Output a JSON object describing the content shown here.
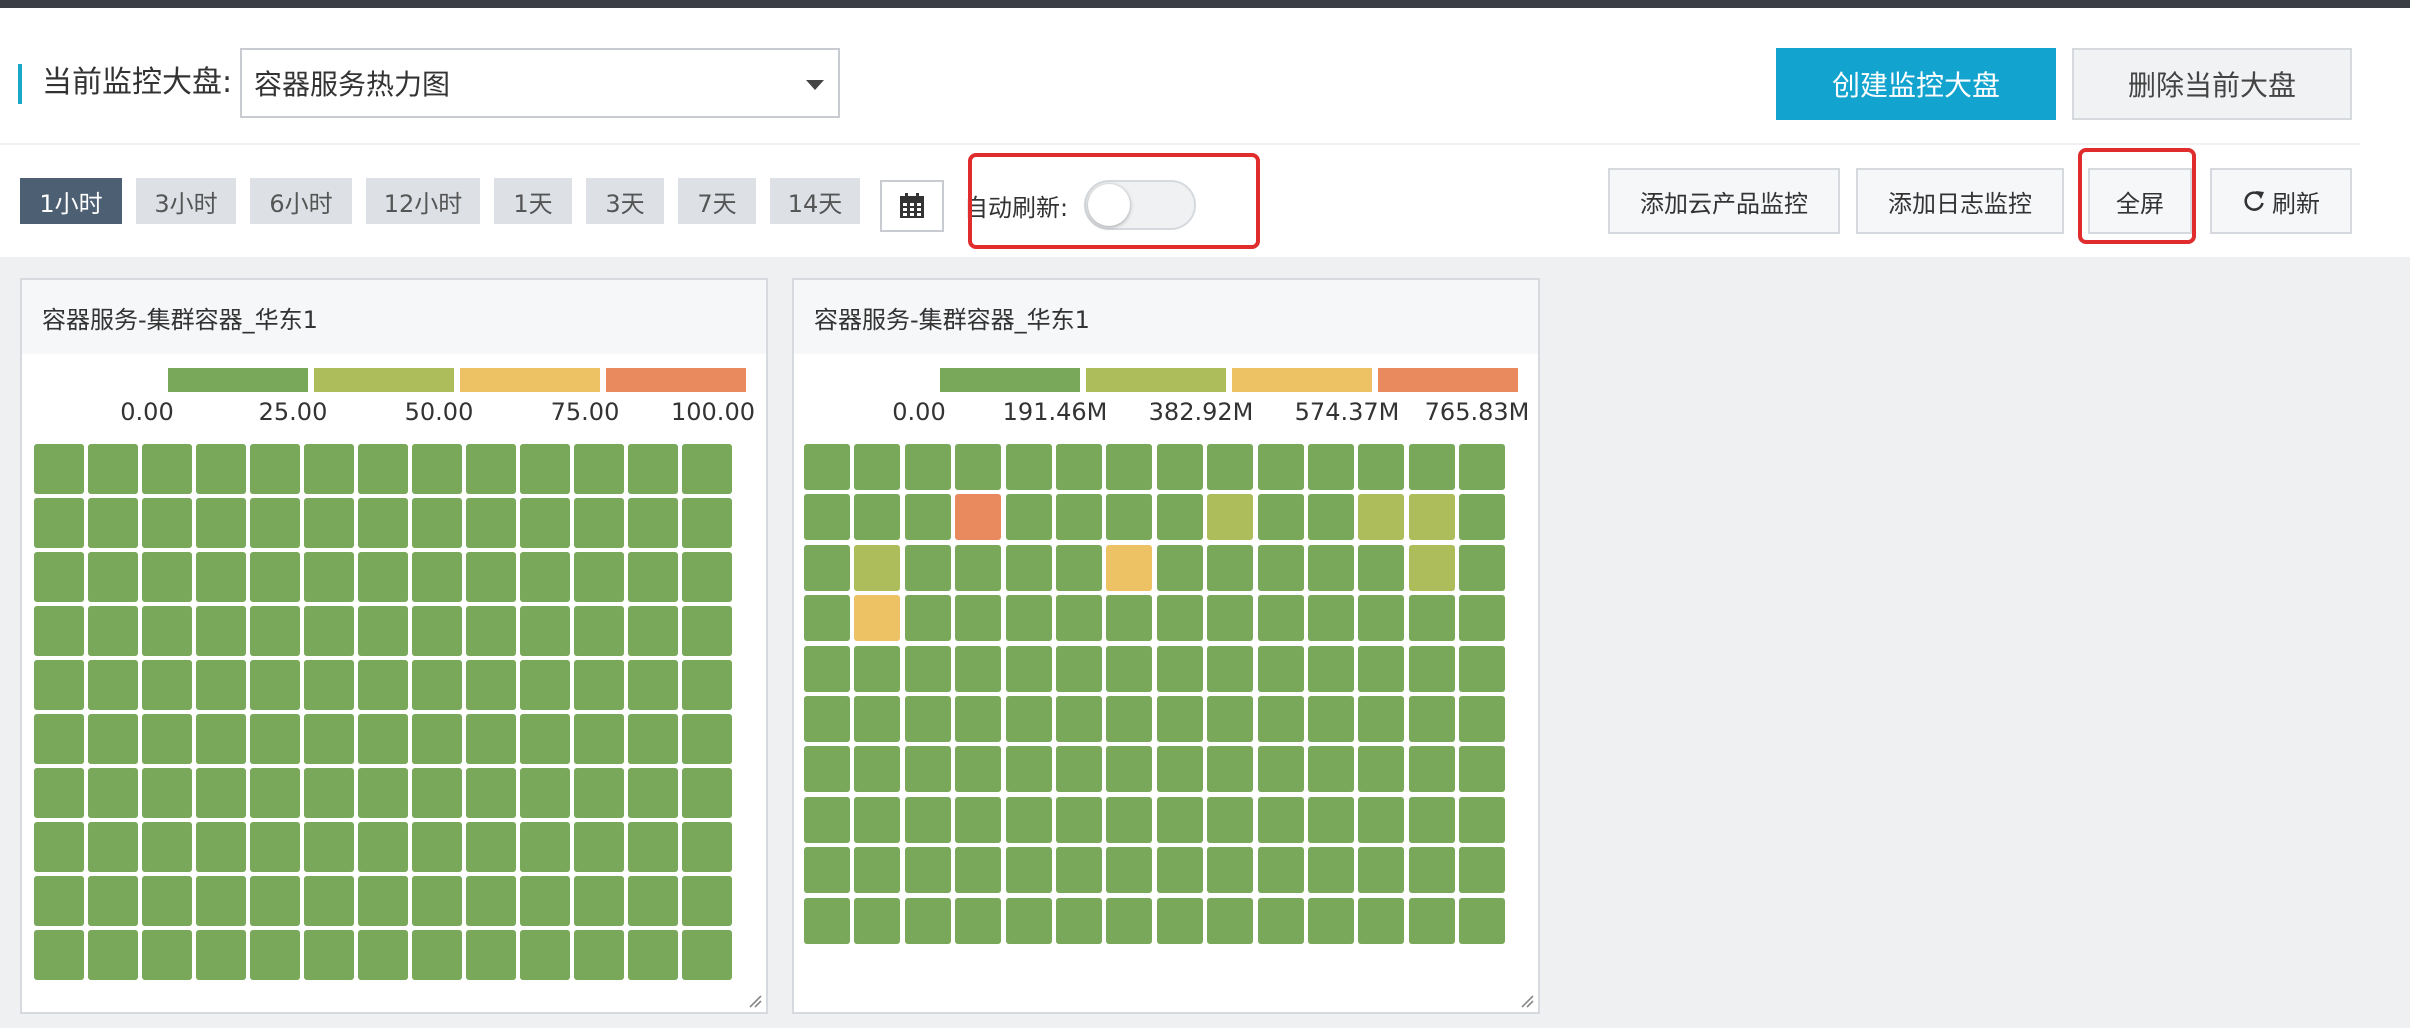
{
  "header": {
    "dashboard_label": "当前监控大盘:",
    "dashboard_selected": "容器服务热力图",
    "create_button": "创建监控大盘",
    "delete_button": "删除当前大盘"
  },
  "toolbar": {
    "time_ranges": [
      "1小时",
      "3小时",
      "6小时",
      "12小时",
      "1天",
      "3天",
      "7天",
      "14天"
    ],
    "active_range": "1小时",
    "auto_refresh_label": "自动刷新:",
    "auto_refresh_on": false,
    "add_cloud_button": "添加云产品监控",
    "add_log_button": "添加日志监控",
    "fullscreen_button": "全屏",
    "refresh_button": "刷新"
  },
  "colors": {
    "accent": "#13a3cf",
    "scale": [
      "#79a85a",
      "#aebd5c",
      "#ecc265",
      "#e8895e"
    ],
    "highlight": "#e02c2c"
  },
  "panels": [
    {
      "title": "容器服务-集群容器_华东1",
      "legend": [
        "0.00",
        "25.00",
        "50.00",
        "75.00",
        "100.00"
      ],
      "rows": 10,
      "cols": 13,
      "levels": [
        [
          0,
          0,
          0,
          0,
          0,
          0,
          0,
          0,
          0,
          0,
          0,
          0,
          0
        ],
        [
          0,
          0,
          0,
          0,
          0,
          0,
          0,
          0,
          0,
          0,
          0,
          0,
          0
        ],
        [
          0,
          0,
          0,
          0,
          0,
          0,
          0,
          0,
          0,
          0,
          0,
          0,
          0
        ],
        [
          0,
          0,
          0,
          0,
          0,
          0,
          0,
          0,
          0,
          0,
          0,
          0,
          0
        ],
        [
          0,
          0,
          0,
          0,
          0,
          0,
          0,
          0,
          0,
          0,
          0,
          0,
          0
        ],
        [
          0,
          0,
          0,
          0,
          0,
          0,
          0,
          0,
          0,
          0,
          0,
          0,
          0
        ],
        [
          0,
          0,
          0,
          0,
          0,
          0,
          0,
          0,
          0,
          0,
          0,
          0,
          0
        ],
        [
          0,
          0,
          0,
          0,
          0,
          0,
          0,
          0,
          0,
          0,
          0,
          0,
          0
        ],
        [
          0,
          0,
          0,
          0,
          0,
          0,
          0,
          0,
          0,
          0,
          0,
          0,
          0
        ],
        [
          0,
          0,
          0,
          0,
          0,
          0,
          0,
          0,
          0,
          0,
          0,
          0,
          0
        ]
      ]
    },
    {
      "title": "容器服务-集群容器_华东1",
      "legend": [
        "0.00",
        "191.46M",
        "382.92M",
        "574.37M",
        "765.83M"
      ],
      "rows": 10,
      "cols": 14,
      "levels": [
        [
          0,
          0,
          0,
          0,
          0,
          0,
          0,
          0,
          0,
          0,
          0,
          0,
          0,
          0
        ],
        [
          0,
          0,
          0,
          3,
          0,
          0,
          0,
          0,
          1,
          0,
          0,
          1,
          1,
          0
        ],
        [
          0,
          1,
          0,
          0,
          0,
          0,
          2,
          0,
          0,
          0,
          0,
          0,
          1,
          0
        ],
        [
          0,
          2,
          0,
          0,
          0,
          0,
          0,
          0,
          0,
          0,
          0,
          0,
          0,
          0
        ],
        [
          0,
          0,
          0,
          0,
          0,
          0,
          0,
          0,
          0,
          0,
          0,
          0,
          0,
          0
        ],
        [
          0,
          0,
          0,
          0,
          0,
          0,
          0,
          0,
          0,
          0,
          0,
          0,
          0,
          0
        ],
        [
          0,
          0,
          0,
          0,
          0,
          0,
          0,
          0,
          0,
          0,
          0,
          0,
          0,
          0
        ],
        [
          0,
          0,
          0,
          0,
          0,
          0,
          0,
          0,
          0,
          0,
          0,
          0,
          0,
          0
        ],
        [
          0,
          0,
          0,
          0,
          0,
          0,
          0,
          0,
          0,
          0,
          0,
          0,
          0,
          0
        ],
        [
          0,
          0,
          0,
          0,
          0,
          0,
          0,
          0,
          0,
          0,
          0,
          0,
          0,
          0
        ]
      ]
    }
  ]
}
